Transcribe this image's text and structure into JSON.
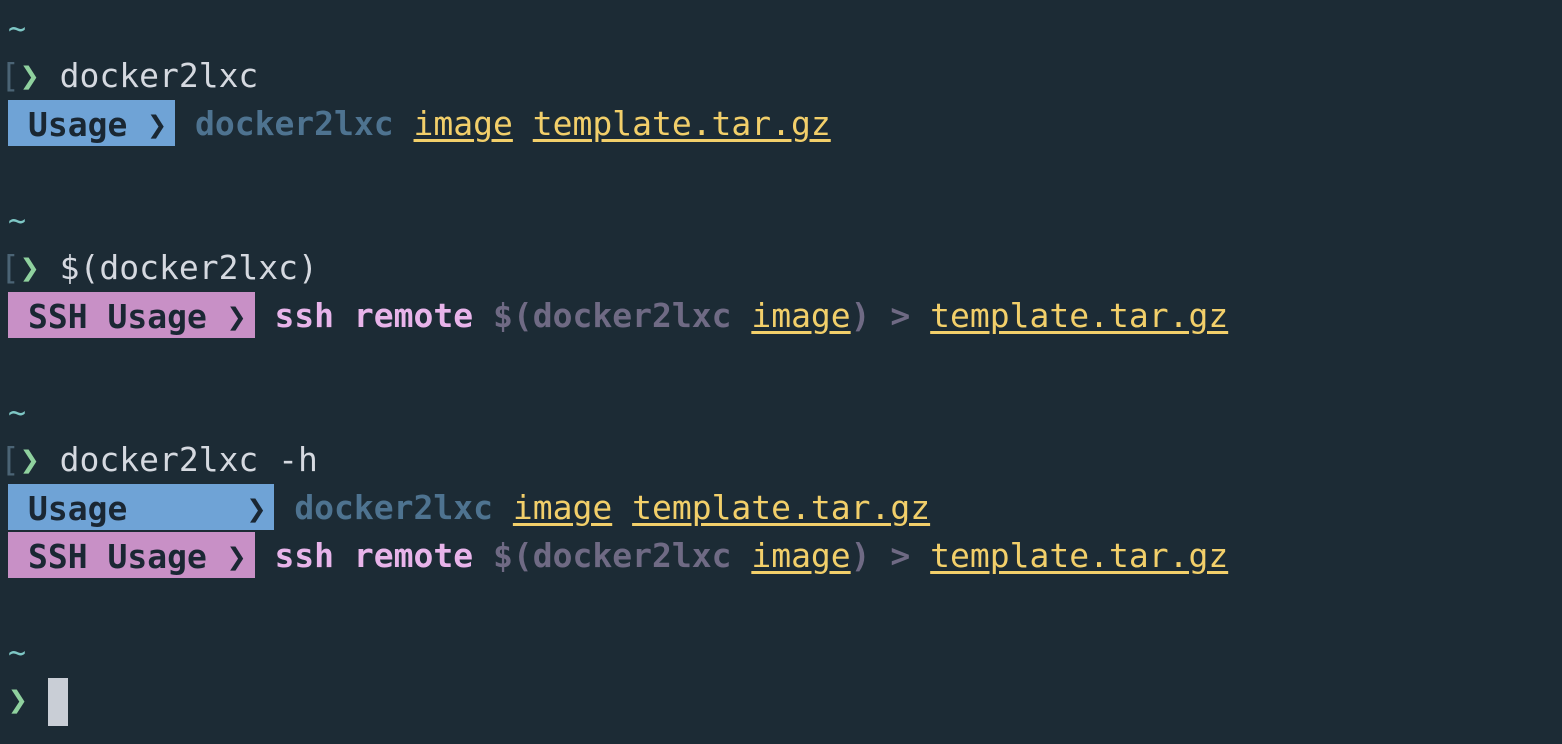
{
  "terminal": {
    "tilde": "~",
    "prompt_bracket": "[",
    "prompt_arrow": "❯",
    "blocks": [
      {
        "command": "docker2lxc"
      },
      {
        "command": "$(docker2lxc)"
      },
      {
        "command": "docker2lxc -h"
      }
    ],
    "usage": {
      "label": "Usage",
      "label_padded": "Usage     ",
      "chevron": "❯",
      "program": "docker2lxc",
      "arg_image": "image",
      "arg_template": "template.tar.gz"
    },
    "ssh_usage": {
      "label": "SSH Usage",
      "chevron": "❯",
      "ssh": "ssh",
      "remote": "remote",
      "subshell_open": "$(",
      "program": "docker2lxc",
      "arg_image": "image",
      "subshell_close": ")",
      "redirect": ">",
      "arg_template": "template.tar.gz"
    },
    "colors": {
      "background": "#1c2b35",
      "usage_label_bg": "#6fa3d6",
      "ssh_label_bg": "#c890c6",
      "argument": "#f2cf6a",
      "prompt_arrow": "#8fd19e"
    }
  }
}
